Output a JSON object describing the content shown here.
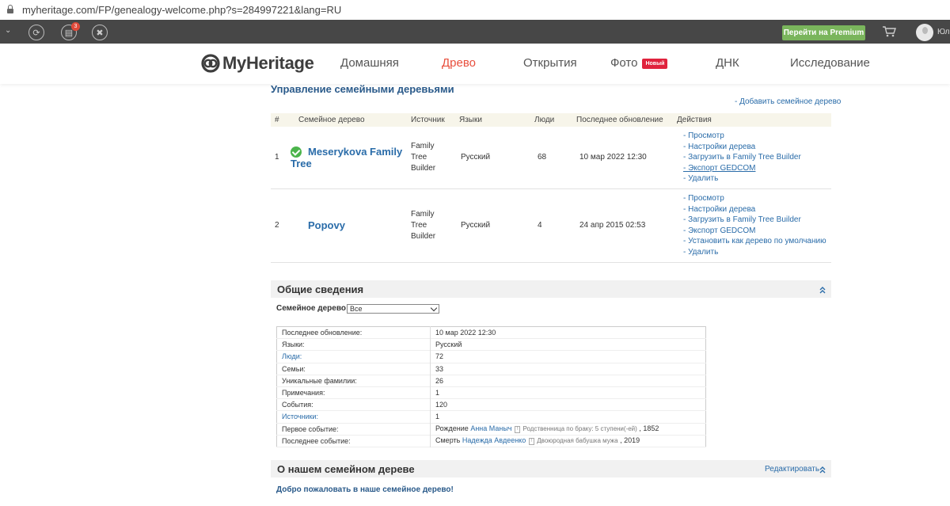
{
  "browser": {
    "url": "myheritage.com/FP/genealogy-welcome.php?s=284997221&lang=RU"
  },
  "toolbar": {
    "badge_count": "3",
    "premium_label": "Перейти на Premium",
    "user_name": "Юл"
  },
  "brand": {
    "logo_text": "MyHeritage"
  },
  "nav": {
    "home": "Домашняя",
    "tree": "Древо",
    "discoveries": "Открытия",
    "photos": "Фото",
    "new_badge": "Новый",
    "dna": "ДНК",
    "research": "Исследование"
  },
  "manage": {
    "title": "Управление семейными деревьями",
    "add_tree": "- Добавить семейное дерево",
    "columns": [
      "#",
      "Семейное дерево",
      "Источник",
      "Языки",
      "Люди",
      "Последнее обновление",
      "Действия"
    ],
    "rows": [
      {
        "num": "1",
        "name": "Meserykova Family Tree",
        "source": [
          "Family",
          "Tree",
          "Builder"
        ],
        "language": "Русский",
        "people": "68",
        "updated": "10 мар 2022 12:30",
        "actions": [
          "- Просмотр",
          "- Настройки дерева",
          "- Загрузить в Family Tree Builder",
          "- Экспорт GEDCOM",
          "- Удалить"
        ]
      },
      {
        "num": "2",
        "name": "Popovy",
        "source": [
          "Family",
          "Tree",
          "Builder"
        ],
        "language": "Русский",
        "people": "4",
        "updated": "24 апр 2015 02:53",
        "actions": [
          "- Просмотр",
          "- Настройки дерева",
          "- Загрузить в Family Tree Builder",
          "- Экспорт GEDCOM",
          "- Установить как дерево по умолчанию",
          "- Удалить"
        ]
      }
    ]
  },
  "overview": {
    "title": "Общие сведения",
    "filter_label": "Семейное дерево:",
    "filter_value": "Все",
    "stats": [
      {
        "key": "Последнее обновление:",
        "value": "10 мар 2022 12:30"
      },
      {
        "key": "Языки:",
        "value": "Русский"
      },
      {
        "key": "Люди:",
        "value": "72"
      },
      {
        "key": "Семьи:",
        "value": "33"
      },
      {
        "key": "Уникальные фамилии:",
        "value": "26"
      },
      {
        "key": "Примечания:",
        "value": "1"
      },
      {
        "key": "События:",
        "value": "120"
      },
      {
        "key": "Источники:",
        "value": "1"
      }
    ],
    "first_event": {
      "key": "Первое событие:",
      "event": "Рождение",
      "person": "Анна Маныч",
      "relation": "Родственница по браку: 5 ступени(-ей)",
      "year": ", 1852"
    },
    "last_event": {
      "key": "Последнее событие:",
      "event": "Смерть",
      "person": "Надежда Авдеенко",
      "relation": "Двоюродная бабушка мужа",
      "year": ", 2019"
    }
  },
  "about": {
    "title": "О нашем семейном дереве",
    "edit": "Редактировать",
    "welcome": "Добро пожаловать в наше семейное дерево!"
  }
}
